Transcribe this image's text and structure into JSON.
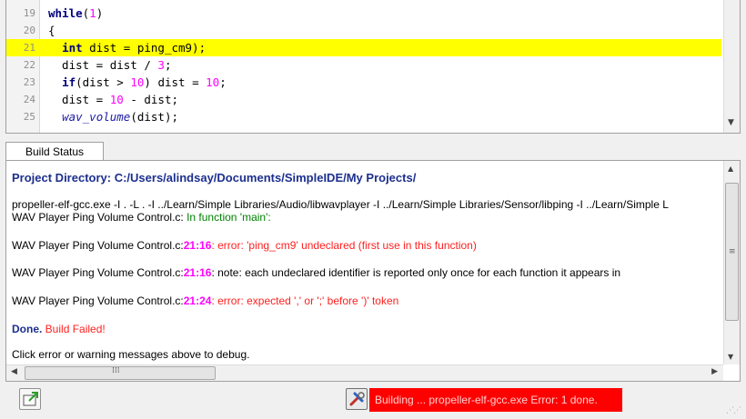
{
  "editor": {
    "lines": [
      {
        "num": "19",
        "indent": "",
        "code": "while(1)"
      },
      {
        "num": "20",
        "indent": "",
        "code": "{"
      },
      {
        "num": "21",
        "indent": "  ",
        "code": "int dist = ping_cm9);"
      },
      {
        "num": "22",
        "indent": "  ",
        "code": "dist = dist / 3;"
      },
      {
        "num": "23",
        "indent": "  ",
        "code": "if(dist > 10) dist = 10;"
      },
      {
        "num": "24",
        "indent": "  ",
        "code": "dist = 10 - dist;"
      },
      {
        "num": "25",
        "indent": "  ",
        "code": "wav_volume(dist);"
      }
    ]
  },
  "build_status": {
    "tab_label": "Build Status",
    "project_dir": "Project Directory: C:/Users/alindsay/Documents/SimpleIDE/My Projects/",
    "command": "propeller-elf-gcc.exe -I . -L . -I ../Learn/Simple Libraries/Audio/libwavplayer -I ../Learn/Simple Libraries/Sensor/libping -I ../Learn/Simple L",
    "in_function": {
      "file": "WAV Player Ping Volume Control.c:",
      "text": " In function 'main':"
    },
    "messages": [
      {
        "file": "WAV Player Ping Volume Control.c:",
        "loc": "21:16",
        "text": ": error: 'ping_cm9' undeclared (first use in this function)",
        "kind": "error"
      },
      {
        "file": "WAV Player Ping Volume Control.c:",
        "loc": "21:16",
        "text": ": note: each undeclared identifier is reported only once for each function it appears in",
        "kind": "note"
      },
      {
        "file": "WAV Player Ping Volume Control.c:",
        "loc": "21:24",
        "text": ": error: expected ',' or ';' before ')' token",
        "kind": "error"
      }
    ],
    "done_label": "Done.",
    "failed_label": " Build Failed!",
    "hint": "Click error or warning messages above to debug."
  },
  "statusbar": {
    "message": "Building ... propeller-elf-gcc.exe Error: 1 done."
  },
  "colors": {
    "highlight_line": "#ffff00",
    "error_text": "#ff2020",
    "location_text": "#ff00ff",
    "banner_bg": "#ff0000"
  },
  "icons": {
    "new_project": "new-project-icon",
    "build": "build-tools-icon"
  }
}
